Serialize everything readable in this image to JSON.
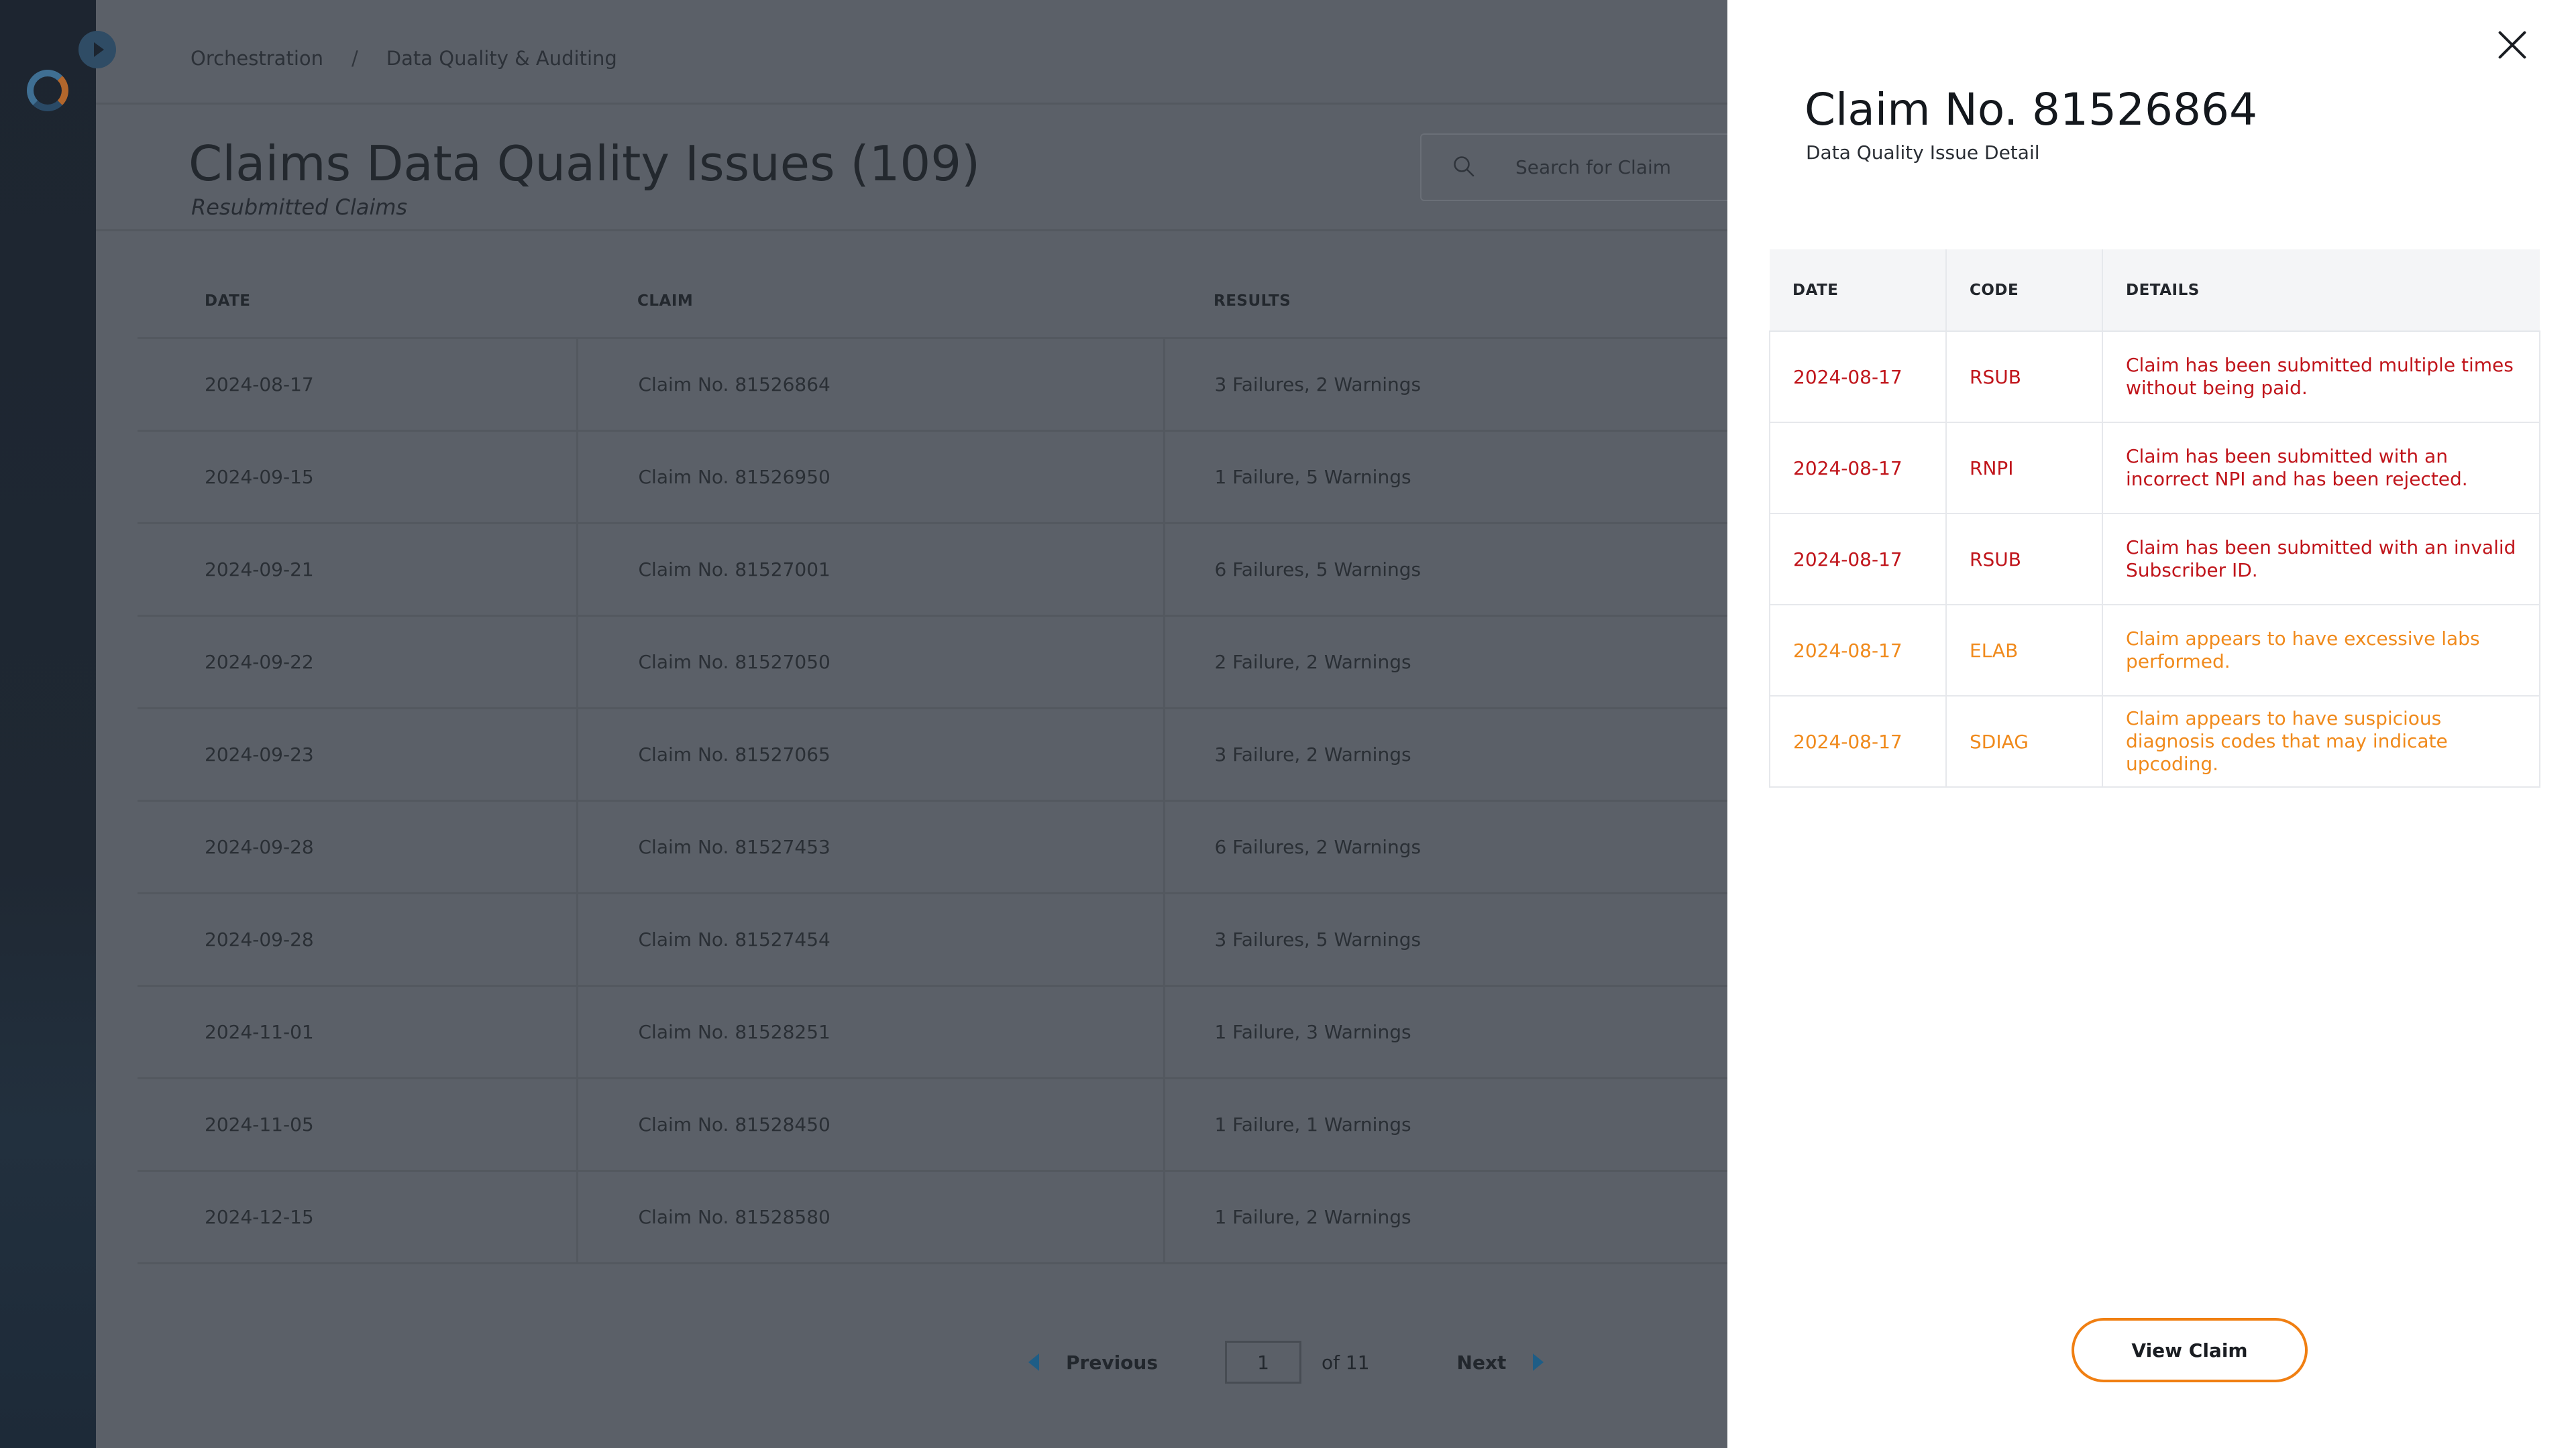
{
  "breadcrumb": {
    "items": [
      "Orchestration",
      "Data Quality & Auditing"
    ],
    "separator": "/"
  },
  "page": {
    "title": "Claims Data Quality Issues (109)",
    "subtitle": "Resubmitted Claims"
  },
  "search": {
    "placeholder": "Search for Claim",
    "icon": "search-icon"
  },
  "table": {
    "headers": [
      "DATE",
      "CLAIM",
      "RESULTS"
    ],
    "rows": [
      {
        "date": "2024-08-17",
        "claim": "Claim No. 81526864",
        "results": "3 Failures, 2 Warnings"
      },
      {
        "date": "2024-09-15",
        "claim": "Claim No. 81526950",
        "results": "1 Failure, 5 Warnings"
      },
      {
        "date": "2024-09-21",
        "claim": "Claim No. 81527001",
        "results": "6 Failures, 5 Warnings"
      },
      {
        "date": "2024-09-22",
        "claim": "Claim No. 81527050",
        "results": "2 Failure, 2 Warnings"
      },
      {
        "date": "2024-09-23",
        "claim": "Claim No. 81527065",
        "results": "3 Failure, 2 Warnings"
      },
      {
        "date": "2024-09-28",
        "claim": "Claim No. 81527453",
        "results": "6 Failures, 2 Warnings"
      },
      {
        "date": "2024-09-28",
        "claim": "Claim No. 81527454",
        "results": "3 Failures, 5 Warnings"
      },
      {
        "date": "2024-11-01",
        "claim": "Claim No. 81528251",
        "results": "1 Failure, 3 Warnings"
      },
      {
        "date": "2024-11-05",
        "claim": "Claim No. 81528450",
        "results": "1 Failure, 1 Warnings"
      },
      {
        "date": "2024-12-15",
        "claim": "Claim No. 81528580",
        "results": "1 Failure, 2 Warnings"
      }
    ]
  },
  "pagination": {
    "previous_label": "Previous",
    "next_label": "Next",
    "current_page": "1",
    "of_label": "of 11"
  },
  "drawer": {
    "title": "Claim No. 81526864",
    "subtitle": "Data Quality Issue Detail",
    "headers": [
      "DATE",
      "CODE",
      "DETAILS"
    ],
    "issues": [
      {
        "date": "2024-08-17",
        "code": "RSUB",
        "details": "Claim has been submitted multiple times without being paid.",
        "severity": "failure"
      },
      {
        "date": "2024-08-17",
        "code": "RNPI",
        "details": "Claim has been submitted with an incorrect NPI and has been rejected.",
        "severity": "failure"
      },
      {
        "date": "2024-08-17",
        "code": "RSUB",
        "details": "Claim has been submitted with an invalid Subscriber ID.",
        "severity": "failure"
      },
      {
        "date": "2024-08-17",
        "code": "ELAB",
        "details": "Claim appears to have excessive labs performed.",
        "severity": "warning"
      },
      {
        "date": "2024-08-17",
        "code": "SDIAG",
        "details": "Claim appears to have suspicious diagnosis codes that may indicate upcoding.",
        "severity": "warning"
      }
    ],
    "view_button_label": "View Claim",
    "close_icon": "close-icon"
  },
  "colors": {
    "failure": "#c0151b",
    "warning": "#f08a1c",
    "accent_button": "#f07f12",
    "overlay": "#5b6068",
    "pager_arrow": "#1e5d86"
  }
}
